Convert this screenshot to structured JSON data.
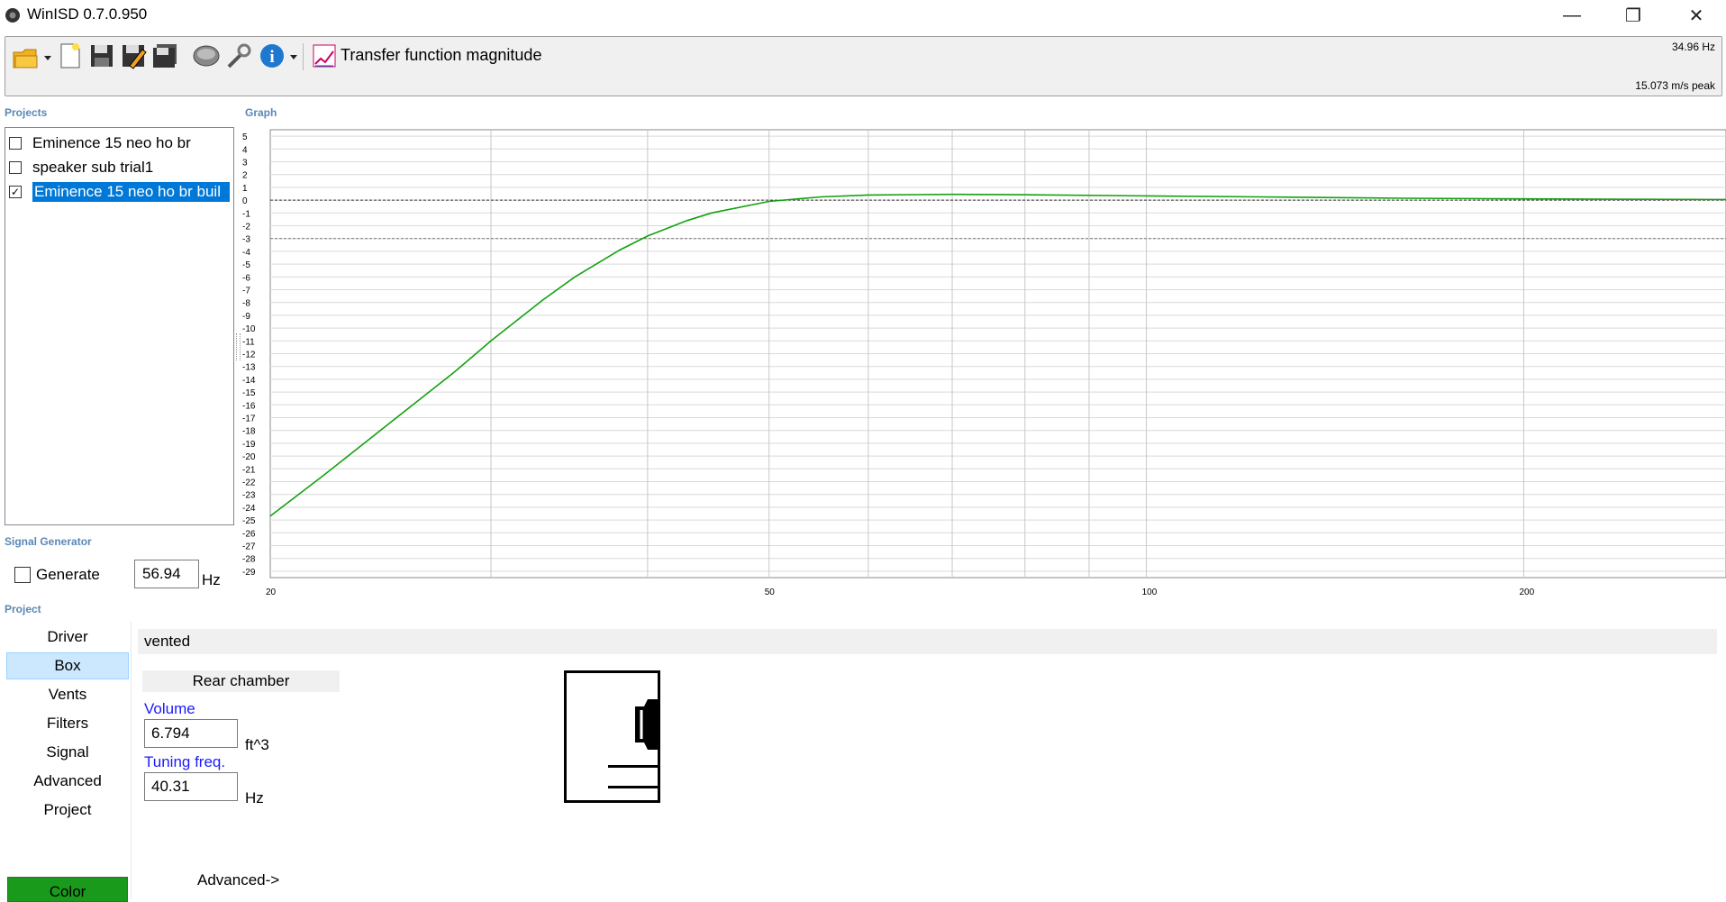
{
  "window": {
    "title": "WinISD 0.7.0.950",
    "minimize_glyph": "—",
    "maximize_glyph": "❐",
    "close_glyph": "✕"
  },
  "toolbar": {
    "icons": [
      "open-folder-icon",
      "new-file-icon",
      "save-icon",
      "save-as-icon",
      "save-all-icon",
      "driver-icon",
      "tools-icon",
      "info-icon",
      "graph-icon"
    ],
    "graph_title": "Transfer function magnitude",
    "readout_freq": "34.96 Hz",
    "readout_accel": "15.073 m/s peak"
  },
  "sections": {
    "projects": "Projects",
    "graph": "Graph",
    "signal_generator": "Signal Generator",
    "project": "Project"
  },
  "projects": [
    {
      "name": "Eminence 15 neo ho br",
      "checked": false,
      "selected": false
    },
    {
      "name": "speaker sub trial1",
      "checked": false,
      "selected": false
    },
    {
      "name": "Eminence 15 neo ho br buil",
      "checked": true,
      "selected": true
    }
  ],
  "signal_generator": {
    "generate_label": "Generate",
    "frequency": "56.94",
    "unit": "Hz"
  },
  "nav": {
    "items": [
      "Driver",
      "Box",
      "Vents",
      "Filters",
      "Signal",
      "Advanced",
      "Project"
    ],
    "selected": "Box",
    "color_button": "Color"
  },
  "box": {
    "type": "vented",
    "rear_chamber_label": "Rear chamber",
    "volume_label": "Volume",
    "volume_value": "6.794",
    "volume_unit": "ft^3",
    "tuning_label": "Tuning freq.",
    "tuning_value": "40.31",
    "tuning_unit": "Hz",
    "advanced_link": "Advanced->"
  },
  "colors": {
    "curve": "#13a10e",
    "selection": "#0078d7",
    "nav_selected": "#cce8ff",
    "color_button": "#1a9a1a",
    "section_label": "#5b87b5"
  },
  "chart_data": {
    "type": "line",
    "x_scale": "log",
    "xlim": [
      20,
      290
    ],
    "ylim": [
      -29,
      5
    ],
    "x_ticks": [
      20,
      50,
      100,
      200
    ],
    "y_ticks": [
      5,
      4,
      3,
      2,
      1,
      0,
      -1,
      -2,
      -3,
      -4,
      -5,
      -6,
      -7,
      -8,
      -9,
      -10,
      -11,
      -12,
      -13,
      -14,
      -15,
      -16,
      -17,
      -18,
      -19,
      -20,
      -21,
      -22,
      -23,
      -24,
      -25,
      -26,
      -27,
      -28,
      -29
    ],
    "reference_lines": [
      0,
      -3
    ],
    "grid": true,
    "series": [
      {
        "x": [
          20,
          22,
          25,
          28,
          30,
          33,
          35,
          38,
          40,
          43,
          45,
          50,
          55,
          60,
          70,
          80,
          100,
          130,
          160,
          200,
          250,
          290
        ],
        "y": [
          -24.7,
          -21.6,
          -17.3,
          -13.5,
          -11.0,
          -7.8,
          -6.0,
          -3.9,
          -2.8,
          -1.6,
          -1.0,
          -0.1,
          0.25,
          0.4,
          0.45,
          0.42,
          0.33,
          0.23,
          0.15,
          0.1,
          0.06,
          0.05
        ]
      }
    ]
  }
}
